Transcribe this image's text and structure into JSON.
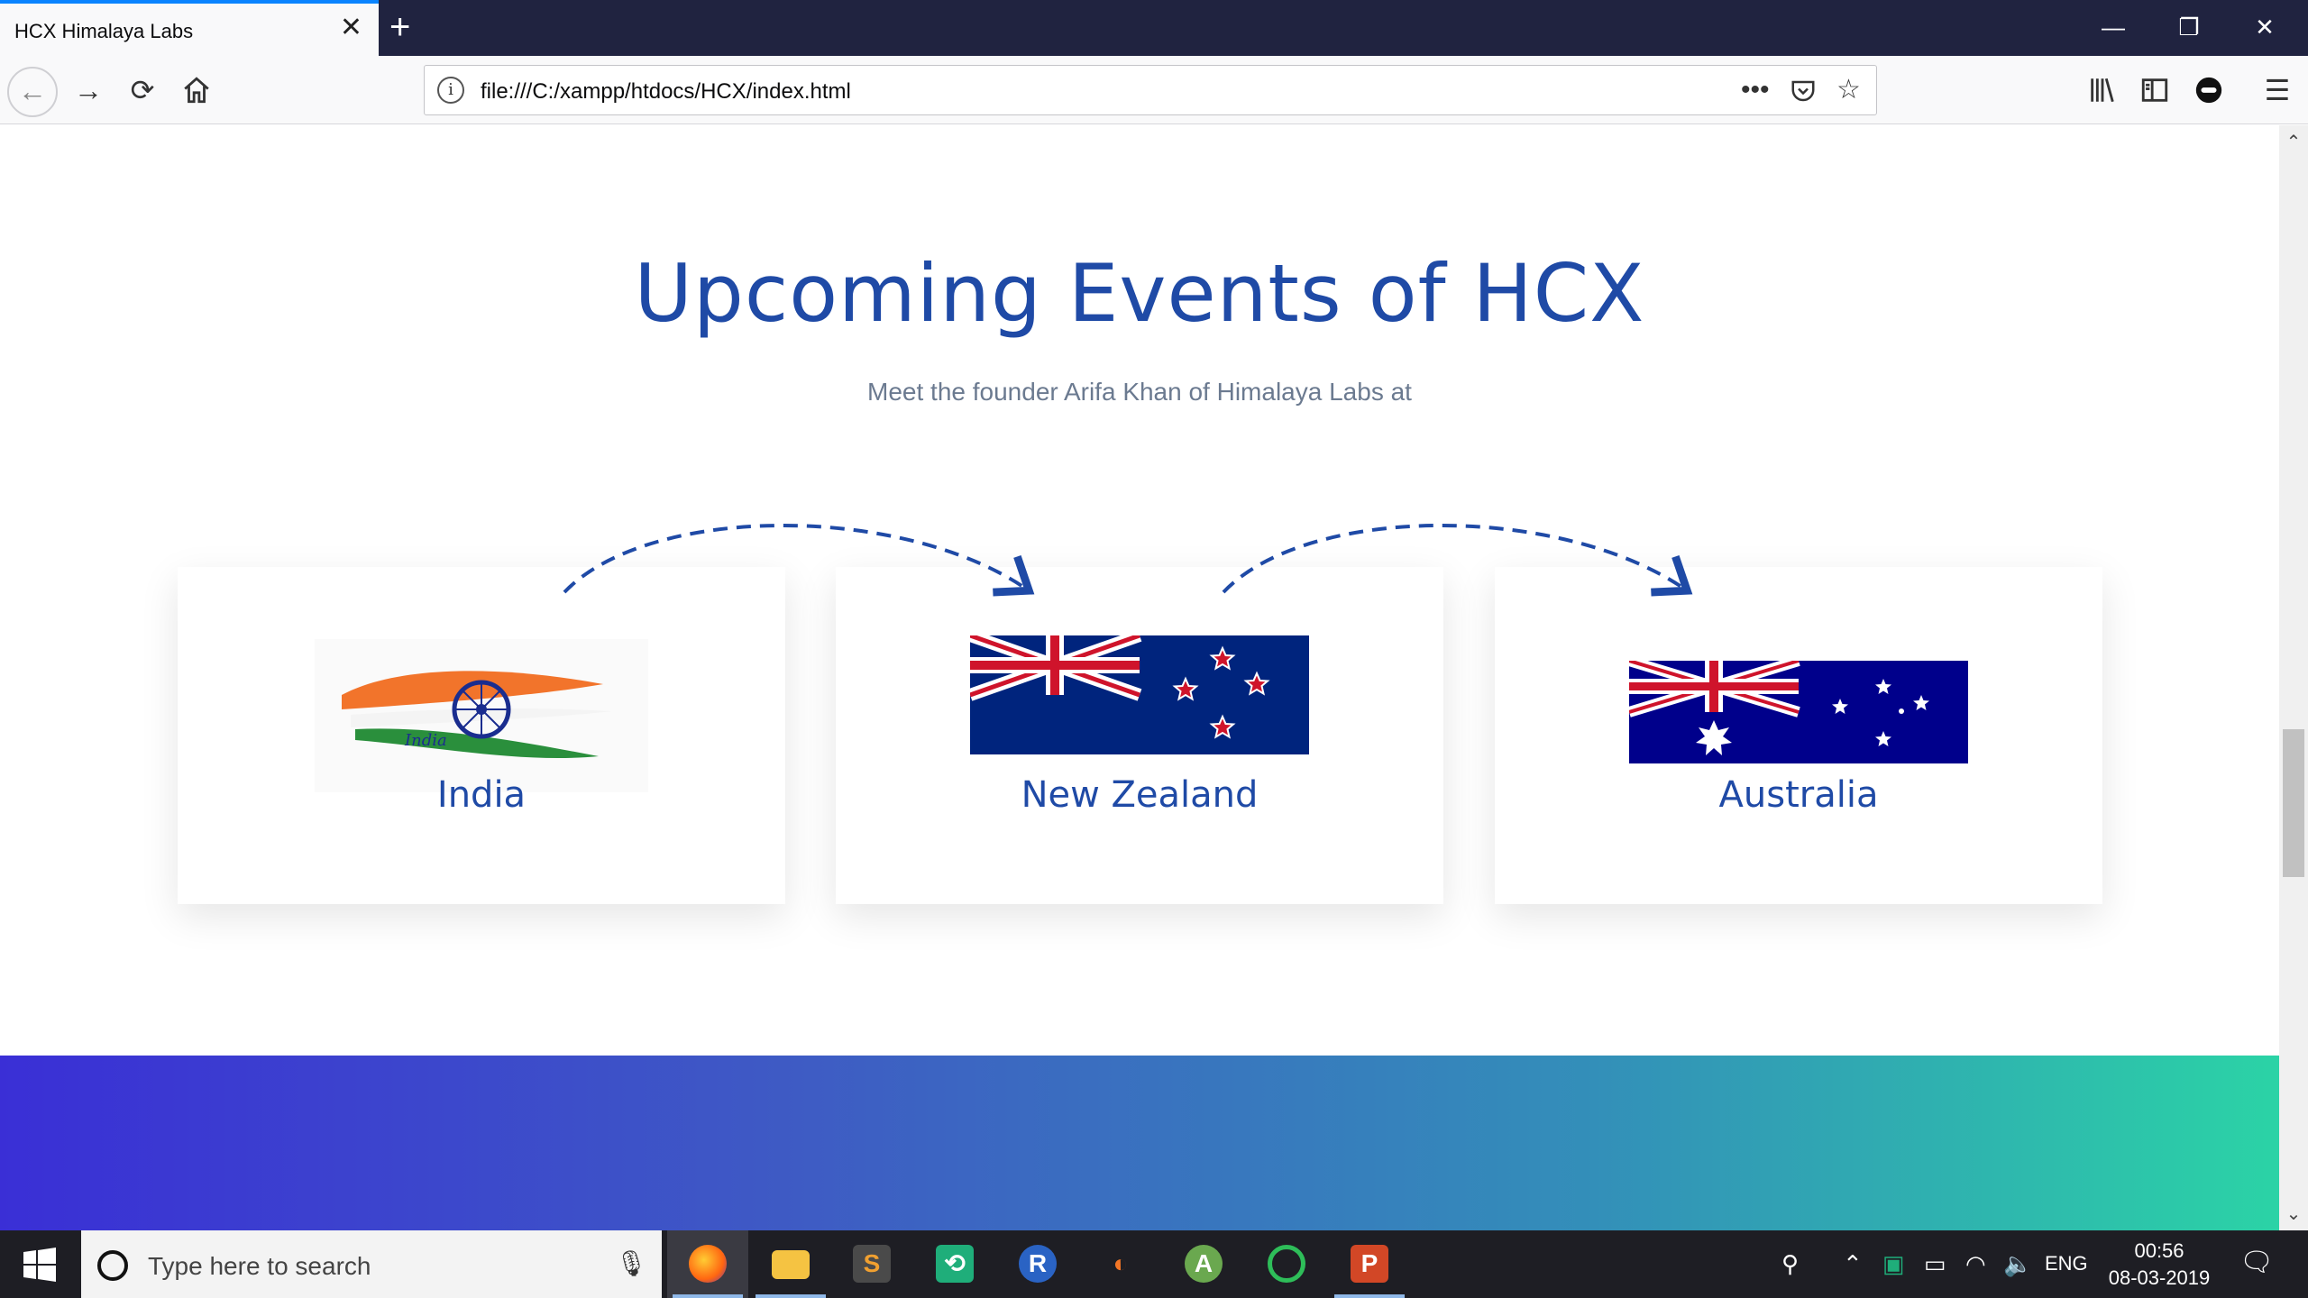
{
  "browser": {
    "tab_title": "HCX Himalaya Labs",
    "url": "file:///C:/xampp/htdocs/HCX/index.html"
  },
  "page": {
    "heading": "Upcoming Events of HCX",
    "subheading": "Meet the founder Arifa Khan of Himalaya Labs at",
    "events": [
      {
        "label": "India",
        "flag": "india-flag"
      },
      {
        "label": "New Zealand",
        "flag": "new-zealand-flag"
      },
      {
        "label": "Australia",
        "flag": "australia-flag"
      }
    ],
    "gradient_colors": [
      "#3a2fd6",
      "#2bd3a6"
    ]
  },
  "taskbar": {
    "search_placeholder": "Type here to search",
    "language": "ENG",
    "time": "00:56",
    "date": "08-03-2019"
  },
  "colors": {
    "accent": "#1f4aa6",
    "tabbar": "#202340"
  }
}
